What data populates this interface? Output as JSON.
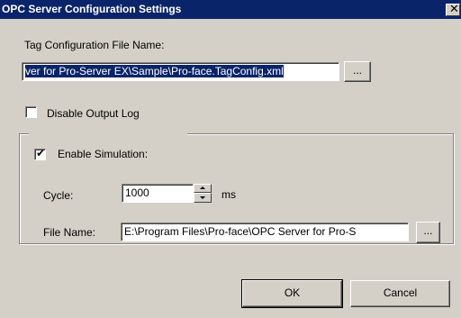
{
  "window": {
    "title": "OPC Server Configuration Settings",
    "close_glyph": "✕"
  },
  "tag_config": {
    "label": "Tag Configuration File Name:",
    "value": "ver for Pro-Server EX\\Sample\\Pro-face.TagConfig.xml",
    "browse_label": "..."
  },
  "disable_output_log": {
    "label": "Disable Output Log",
    "checked": false
  },
  "simulation": {
    "label": "Enable Simulation:",
    "checked": true,
    "check_glyph": "✔",
    "cycle_label": "Cycle:",
    "cycle_value": "1000",
    "cycle_unit": "ms",
    "file_label": "File Name:",
    "file_value": "E:\\Program Files\\Pro-face\\OPC Server for Pro-S",
    "browse_label": "..."
  },
  "buttons": {
    "ok": "OK",
    "cancel": "Cancel"
  },
  "colors": {
    "titlebar": "#0a246a",
    "dialog_bg": "#d4d0c8",
    "selection": "#0a246a"
  }
}
